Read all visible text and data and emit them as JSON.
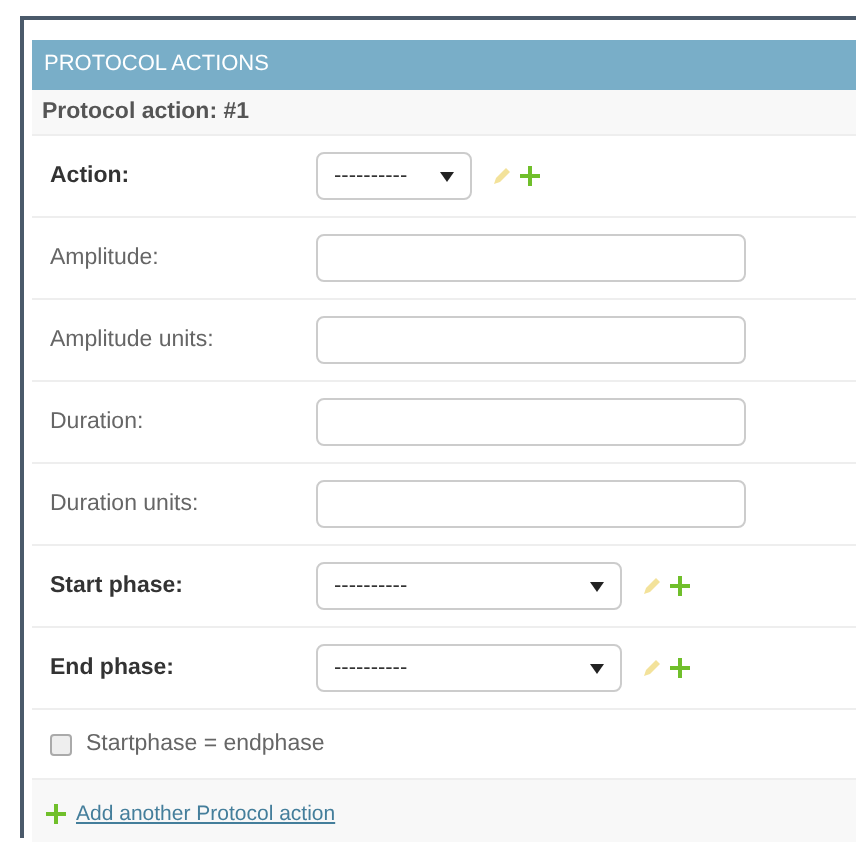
{
  "module": {
    "title": "PROTOCOL ACTIONS"
  },
  "inline": {
    "title": "Protocol action: #1"
  },
  "fields": [
    {
      "label": "Action:",
      "kind": "select",
      "required": true,
      "value": "----------"
    },
    {
      "label": "Amplitude:",
      "kind": "text",
      "required": false
    },
    {
      "label": "Amplitude units:",
      "kind": "text",
      "required": false
    },
    {
      "label": "Duration:",
      "kind": "text",
      "required": false
    },
    {
      "label": "Duration units:",
      "kind": "text",
      "required": false
    },
    {
      "label": "Start phase:",
      "kind": "wide_select",
      "required": true,
      "value": "----------"
    },
    {
      "label": "End phase:",
      "kind": "wide_select",
      "required": true,
      "value": "----------"
    }
  ],
  "checkbox": {
    "label": "Startphase = endphase",
    "checked": false
  },
  "add_link": {
    "label": "Add another Protocol action"
  }
}
